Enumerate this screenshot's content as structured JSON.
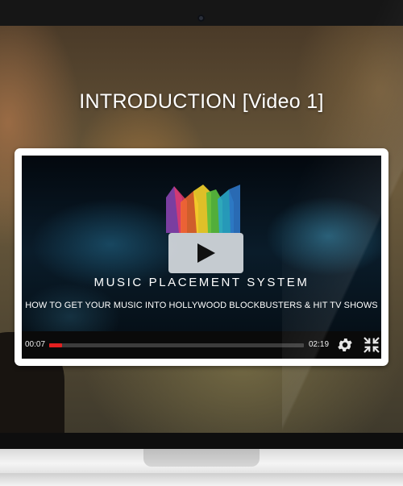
{
  "page": {
    "title": "INTRODUCTION [Video 1]"
  },
  "video": {
    "brand_title": "MUSIC PLACEMENT SYSTEM",
    "tagline": "HOW TO GET YOUR MUSIC INTO HOLLYWOOD BLOCKBUSTERS & HIT TV SHOWS",
    "play_icon": "play-icon",
    "logo_icon": "rainbow-crown-logo"
  },
  "controls": {
    "current_time": "00:07",
    "total_time": "02:19",
    "progress_fraction": 0.05,
    "progress_color": "#e22020",
    "settings_icon": "gear-icon",
    "exit_fullscreen_icon": "exit-fullscreen-icon"
  }
}
